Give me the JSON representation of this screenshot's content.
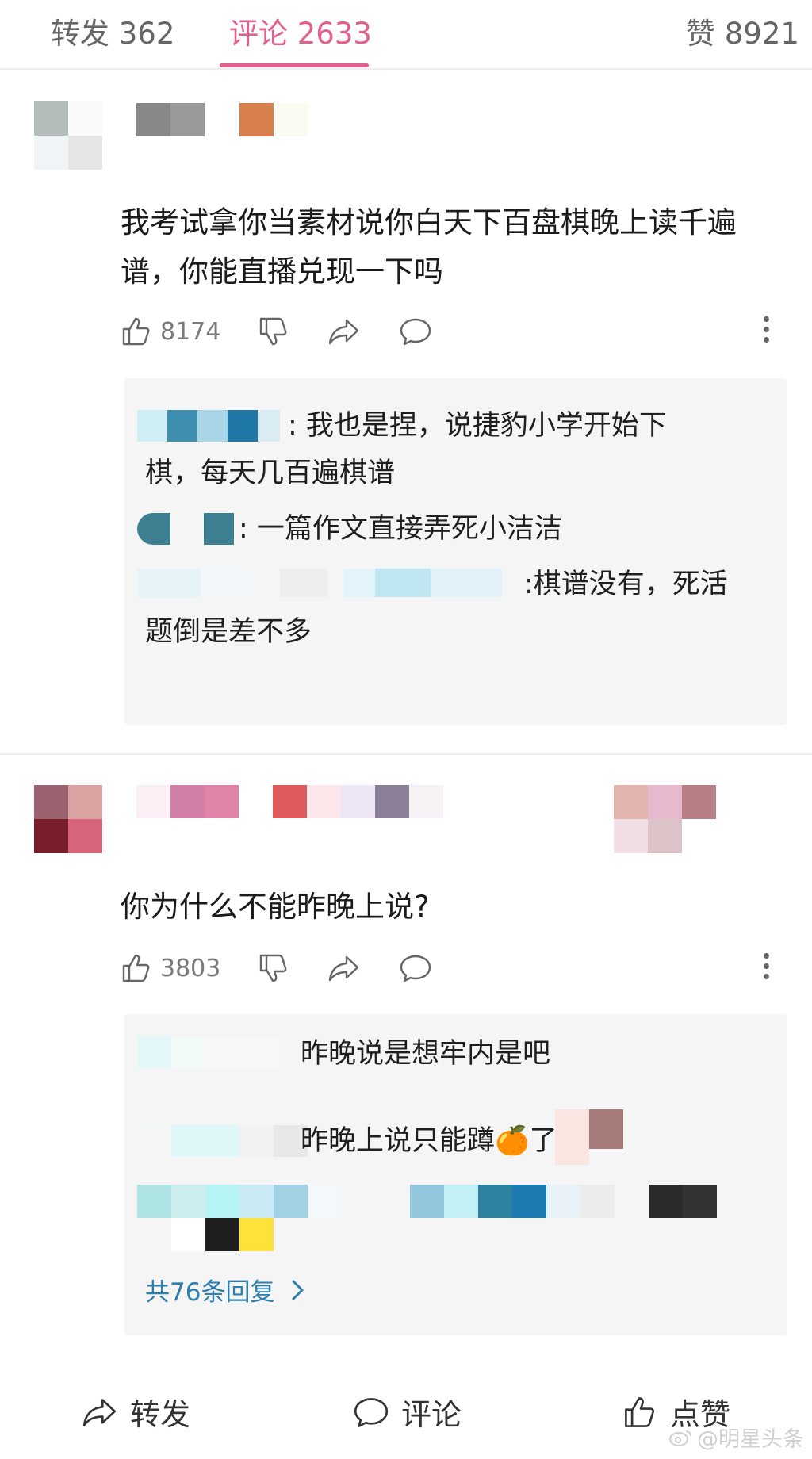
{
  "tabs": [
    {
      "label": "转发",
      "count": "362"
    },
    {
      "label": "评论",
      "count": "2633"
    },
    {
      "label": "赞",
      "count": "8921"
    }
  ],
  "comments": [
    {
      "text_line1": "我考试拿你当素材说你白天下百盘棋晚上读千遍",
      "text_line2": "谱，你能直播兑现一下吗",
      "likes": "8174",
      "replies": [
        {
          "line1": ": 我也是捏，说捷豹小学开始下",
          "line2": "棋，每天几百遍棋谱"
        },
        {
          "line1": ": 一篇作文直接弄死小洁洁"
        },
        {
          "line1": ":棋谱没有，死活",
          "line2": "题倒是差不多"
        }
      ]
    },
    {
      "text_line1": "你为什么不能昨晚上说?",
      "likes": "3803",
      "replies": [
        {
          "line1": "昨晚说是想牢内是吧"
        },
        {
          "line1": "昨晚上说只能蹲🍊了"
        }
      ],
      "more_replies": "共76条回复"
    }
  ],
  "bottom_bar": {
    "forward": "转发",
    "comment": "评论",
    "like": "点赞"
  },
  "watermark": "@明星头条",
  "colors": {
    "accent": "#e0608e",
    "link": "#2d7fb0",
    "reply_bg": "#f5f5f5"
  },
  "icons": [
    "thumbs-up-icon",
    "thumbs-down-icon",
    "share-icon",
    "comment-bubble-icon",
    "more-vertical-icon",
    "chevron-right-icon"
  ]
}
